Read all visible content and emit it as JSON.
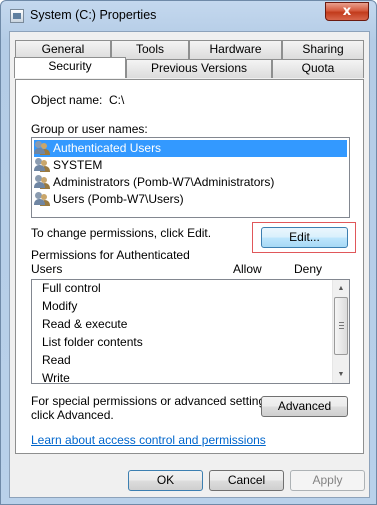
{
  "window": {
    "title": "System (C:) Properties",
    "close_glyph": "x"
  },
  "tabs": {
    "row_top": [
      "General",
      "Tools",
      "Hardware",
      "Sharing"
    ],
    "row_bottom": [
      "Security",
      "Previous Versions",
      "Quota"
    ],
    "active": "Security"
  },
  "security": {
    "object_name_label": "Object name:",
    "object_name_value": "C:\\",
    "group_label": "Group or user names:",
    "users": [
      {
        "name": "Authenticated Users",
        "selected": true
      },
      {
        "name": "SYSTEM",
        "selected": false
      },
      {
        "name": "Administrators (Pomb-W7\\Administrators)",
        "selected": false
      },
      {
        "name": "Users (Pomb-W7\\Users)",
        "selected": false
      }
    ],
    "change_text": "To change permissions, click Edit.",
    "edit_button": "Edit...",
    "permissions_label_line1": "Permissions for Authenticated",
    "permissions_label_line2": "Users",
    "allow_header": "Allow",
    "deny_header": "Deny",
    "permissions": [
      "Full control",
      "Modify",
      "Read & execute",
      "List folder contents",
      "Read",
      "Write"
    ],
    "special_text_line1": "For special permissions or advanced settings,",
    "special_text_line2": "click Advanced.",
    "advanced_button": "Advanced",
    "learn_link": "Learn about access control and permissions"
  },
  "footer": {
    "ok": "OK",
    "cancel": "Cancel",
    "apply": "Apply"
  },
  "colors": {
    "selection": "#3399ff",
    "link": "#0066cc",
    "highlight_box": "#e0575a"
  }
}
